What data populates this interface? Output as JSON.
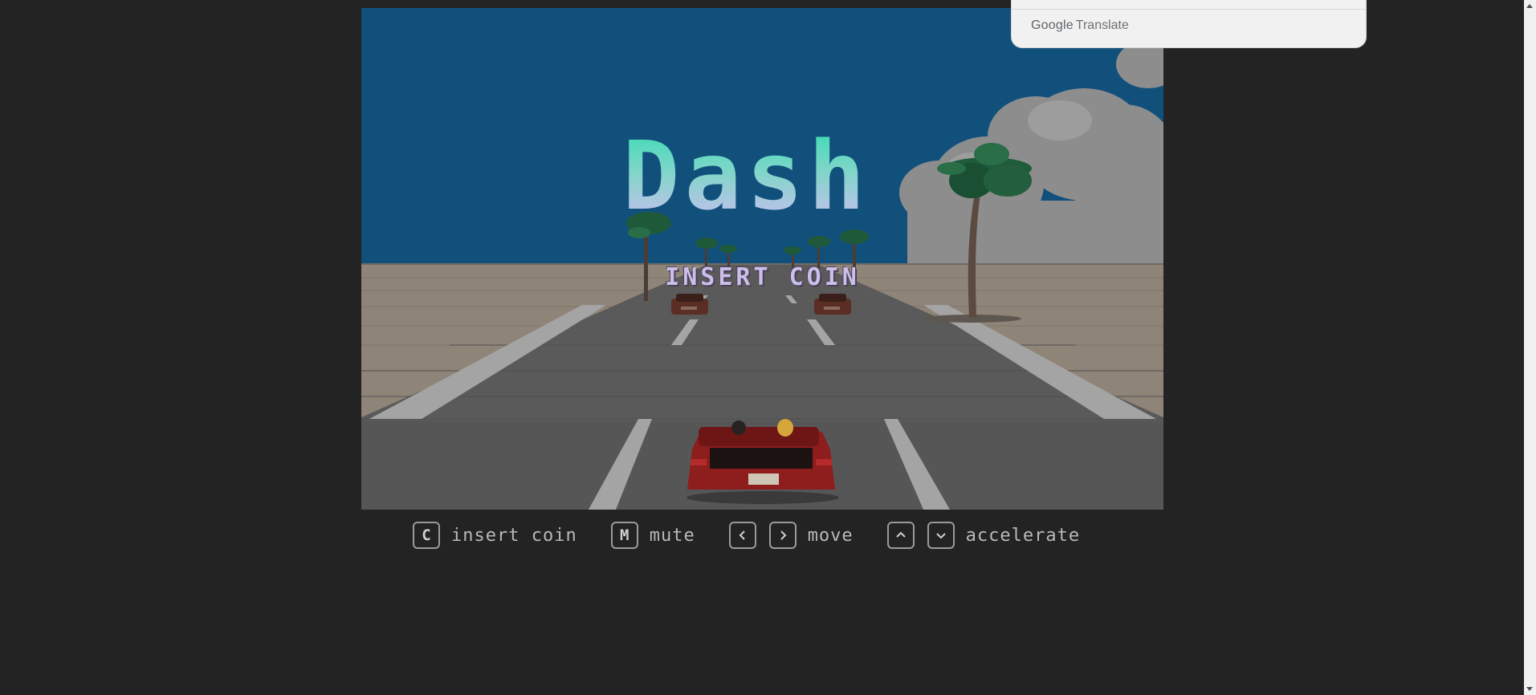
{
  "game": {
    "title": "Dash",
    "insert_coin": "INSERT COIN"
  },
  "controls": {
    "insert_coin": {
      "key": "C",
      "label": "insert coin"
    },
    "mute": {
      "key": "M",
      "label": "mute"
    },
    "move": {
      "keys": [
        "<",
        ">"
      ],
      "label": "move"
    },
    "accelerate": {
      "keys": [
        "^",
        "v"
      ],
      "label": "accelerate"
    }
  },
  "translate": {
    "brand": "Google",
    "product": "Translate"
  },
  "colors": {
    "page_background": "#232323",
    "sky": "#12507c",
    "road": "#5a5a5a",
    "sand": "#8f8478",
    "title_top": "#3ddbb6",
    "title_bottom": "#c8bff0",
    "car": "#8e1d1d"
  },
  "icons": {
    "left": "chevron-left-icon",
    "right": "chevron-right-icon",
    "up": "chevron-up-icon",
    "down": "chevron-down-icon"
  }
}
